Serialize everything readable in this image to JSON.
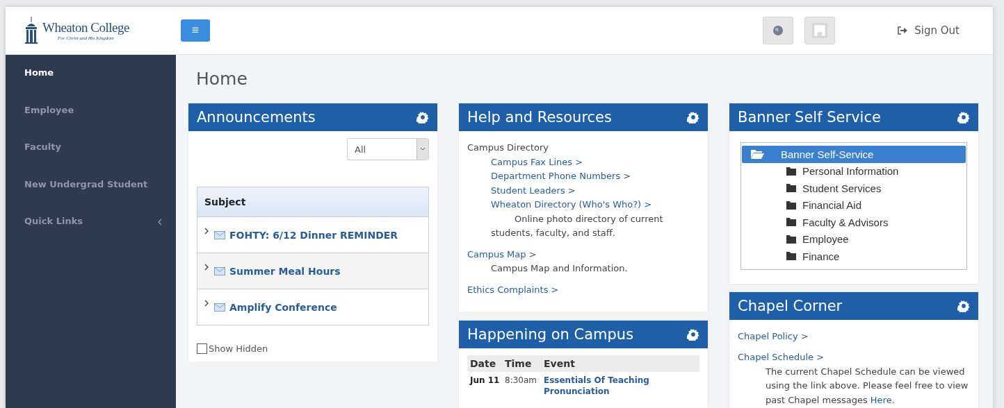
{
  "header": {
    "logo_name": "Wheaton College",
    "logo_tagline": "For Christ and His Kingdom",
    "menu_button": "≡",
    "sign_out": "Sign Out"
  },
  "sidebar": {
    "items": [
      {
        "label": "Home",
        "selected": true,
        "expandable": false
      },
      {
        "label": "Employee",
        "selected": false,
        "expandable": false
      },
      {
        "label": "Faculty",
        "selected": false,
        "expandable": false
      },
      {
        "label": "New Undergrad Student",
        "selected": false,
        "expandable": false
      },
      {
        "label": "Quick Links",
        "selected": false,
        "expandable": true
      }
    ]
  },
  "page_title": "Home",
  "announcements": {
    "title": "Announcements",
    "filter": "All",
    "column": "Subject",
    "rows": [
      {
        "subject": "FOHTY: 6/12 Dinner REMINDER"
      },
      {
        "subject": "Summer Meal Hours"
      },
      {
        "subject": "Amplify Conference"
      }
    ],
    "show_hidden": {
      "label": "Show Hidden",
      "checked": false
    }
  },
  "help": {
    "title": "Help and Resources",
    "sections": [
      {
        "heading": "Campus Directory",
        "links": [
          "Campus Fax Lines >",
          "Department Phone Numbers >",
          "Student Leaders >",
          "Wheaton Directory (Who's Who?) >"
        ],
        "description": "Online photo directory of current students, faculty, and staff."
      },
      {
        "link": "Campus Map >",
        "description": "Campus Map and Information."
      },
      {
        "link": "Ethics Complaints >"
      }
    ]
  },
  "happening": {
    "title": "Happening on Campus",
    "columns": [
      "Date",
      "Time",
      "Event"
    ],
    "rows": [
      {
        "date": "Jun 11",
        "time": "8:30am",
        "event": "Essentials Of Teaching Pronunciation"
      }
    ]
  },
  "banner": {
    "title": "Banner Self Service",
    "tree": [
      {
        "label": "Banner Self-Service",
        "selected": true,
        "children": [
          {
            "label": "Personal Information",
            "selected": false
          },
          {
            "label": "Student Services",
            "selected": false
          },
          {
            "label": "Financial Aid",
            "selected": false
          },
          {
            "label": "Faculty & Advisors",
            "selected": false
          },
          {
            "label": "Employee",
            "selected": false
          },
          {
            "label": "Finance",
            "selected": false
          }
        ]
      }
    ]
  },
  "chapel": {
    "title": "Chapel Corner",
    "items": [
      {
        "link": "Chapel Policy >"
      },
      {
        "link": "Chapel Schedule >",
        "description": "The current Chapel Schedule can be viewed using the link above. Please feel free to view past Chapel messages",
        "inline_link": "Here",
        "tail": "."
      }
    ]
  }
}
